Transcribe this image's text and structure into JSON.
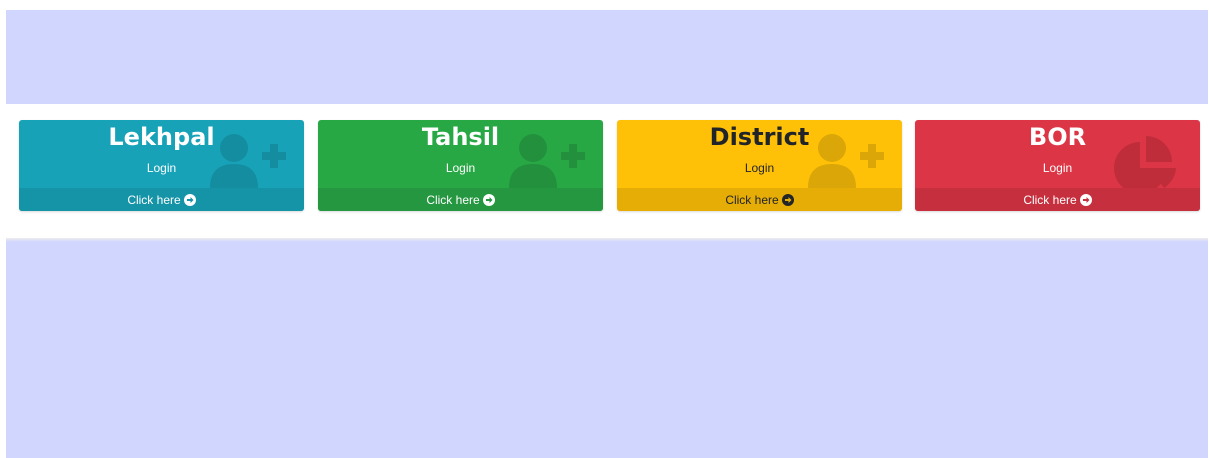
{
  "cards": [
    {
      "title": "Lekhpal",
      "subtitle": "Login",
      "link": "Click here",
      "icon": "user-plus-icon",
      "color": "#17a2b8",
      "footer_color": "#1593a7",
      "icon_color": "#148da0"
    },
    {
      "title": "Tahsil",
      "subtitle": "Login",
      "link": "Click here",
      "icon": "user-plus-icon",
      "color": "#28a745",
      "footer_color": "#249740",
      "icon_color": "#23903e"
    },
    {
      "title": "District",
      "subtitle": "Login",
      "link": "Click here",
      "icon": "user-plus-icon",
      "color": "#ffc107",
      "footer_color": "#e6ad06",
      "icon_color": "#dba607"
    },
    {
      "title": "BOR",
      "subtitle": "Login",
      "link": "Click here",
      "icon": "pie-chart-icon",
      "color": "#dc3545",
      "footer_color": "#c6303e",
      "icon_color": "#bf2d3b"
    }
  ]
}
